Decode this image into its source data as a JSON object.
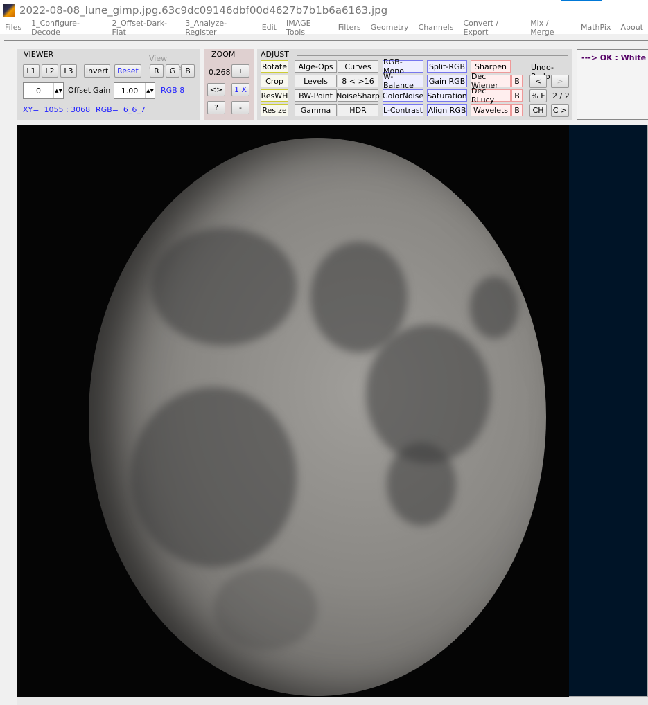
{
  "window": {
    "title": "2022-08-08_lune_gimp.jpg.63c9dc09146dbf00d4627b7b1b6a6163.jpg"
  },
  "menu": [
    "Files",
    "1_Configure-Decode",
    "2_Offset-Dark-Flat",
    "3_Analyze-Register",
    "Edit",
    "IMAGE Tools",
    "Filters",
    "Geometry",
    "Channels",
    "Convert / Export",
    "Mix / Merge",
    "MathPix",
    "About"
  ],
  "viewer": {
    "title": "VIEWER",
    "view_channels": "View channels",
    "l1": "L1",
    "l2": "L2",
    "l3": "L3",
    "invert": "Invert",
    "reset": "Reset",
    "r": "R",
    "g": "G",
    "b": "B",
    "offset_value": "0",
    "offset_label": "Offset",
    "gain_label": "Gain",
    "gain_value": "1.00",
    "rgb_mode": "RGB 8",
    "xy": "XY=  1055 : 3068",
    "rgb": "RGB=  6_6_7"
  },
  "zoom": {
    "title": "ZOOM",
    "value": "0.268",
    "plus": "+",
    "fit": "<>",
    "one": "1 X",
    "help": "?",
    "minus": "-"
  },
  "adjust": {
    "title": "ADJUST",
    "undo_redo": "Undo-Redo",
    "counter": "2 / 2",
    "col1": [
      "Rotate",
      "Crop",
      "ResWH",
      "Resize"
    ],
    "col2": [
      "Alge-Ops",
      "Levels",
      "BW-Point",
      "Gamma"
    ],
    "col3": [
      "Curves",
      "8 < >16",
      "NoiseSharp",
      "HDR"
    ],
    "col4": [
      "RGB-Mono",
      "W-Balance",
      "ColorNoise",
      "L-Contrast"
    ],
    "col5": [
      "Split-RGB",
      "Gain RGB",
      "Saturation",
      "Align RGB"
    ],
    "col6": [
      "Sharpen",
      "Dec Wiener",
      "Dec RLucy",
      "Wavelets"
    ],
    "b": "B",
    "undo": "<",
    "redo": ">",
    "pf": "% F",
    "ch": "CH",
    "c": "C >"
  },
  "message": "---> OK :  White B"
}
